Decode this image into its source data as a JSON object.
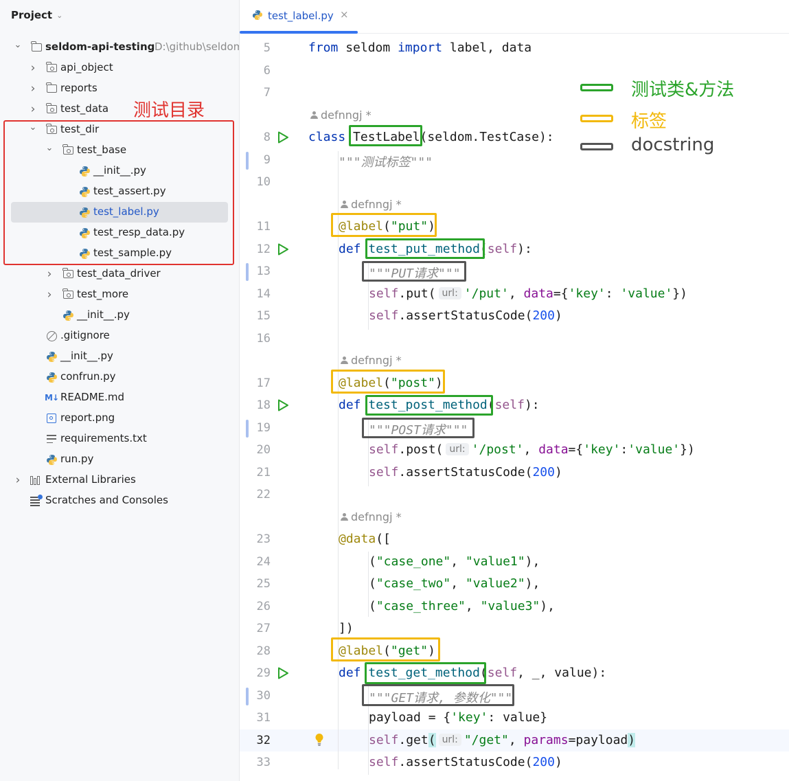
{
  "sidebar": {
    "header": "Project",
    "annotation": "测试目录",
    "items": [
      {
        "label": "seldom-api-testing",
        "path": "D:\\github\\seldom",
        "icon": "folder-icon"
      },
      {
        "label": "api_object",
        "icon": "package-folder-icon"
      },
      {
        "label": "reports",
        "icon": "folder-icon"
      },
      {
        "label": "test_data",
        "icon": "package-folder-icon"
      },
      {
        "label": "test_dir",
        "icon": "package-folder-icon"
      },
      {
        "label": "test_base",
        "icon": "package-folder-icon"
      },
      {
        "label": "__init__.py",
        "icon": "python-file-icon"
      },
      {
        "label": "test_assert.py",
        "icon": "python-file-icon"
      },
      {
        "label": "test_label.py",
        "icon": "python-file-icon"
      },
      {
        "label": "test_resp_data.py",
        "icon": "python-file-icon"
      },
      {
        "label": "test_sample.py",
        "icon": "python-file-icon"
      },
      {
        "label": "test_data_driver",
        "icon": "package-folder-icon"
      },
      {
        "label": "test_more",
        "icon": "package-folder-icon"
      },
      {
        "label": "__init__.py",
        "icon": "python-file-icon"
      },
      {
        "label": ".gitignore",
        "icon": "gitignore-icon"
      },
      {
        "label": "__init__.py",
        "icon": "python-file-icon"
      },
      {
        "label": "confrun.py",
        "icon": "python-file-icon"
      },
      {
        "label": "README.md",
        "icon": "markdown-icon"
      },
      {
        "label": "report.png",
        "icon": "image-file-icon"
      },
      {
        "label": "requirements.txt",
        "icon": "text-file-icon"
      },
      {
        "label": "run.py",
        "icon": "python-file-icon"
      },
      {
        "label": "External Libraries",
        "icon": "library-icon"
      },
      {
        "label": "Scratches and Consoles",
        "icon": "scratches-icon"
      }
    ]
  },
  "editor": {
    "tab": {
      "label": "test_label.py",
      "close": "×"
    },
    "author": "defnngj *",
    "hint_url": "url:",
    "line_numbers": [
      "5",
      "6",
      "7",
      "8",
      "9",
      "10",
      "11",
      "12",
      "13",
      "14",
      "15",
      "16",
      "17",
      "18",
      "19",
      "20",
      "21",
      "22",
      "23",
      "24",
      "25",
      "26",
      "27",
      "28",
      "29",
      "30",
      "31",
      "32",
      "33"
    ]
  },
  "legend": {
    "items": [
      {
        "text": "测试类&方法",
        "color": "#2ba42b"
      },
      {
        "text": "标签",
        "color": "#f2b90d"
      },
      {
        "text": "docstring",
        "color": "#555555"
      }
    ]
  }
}
